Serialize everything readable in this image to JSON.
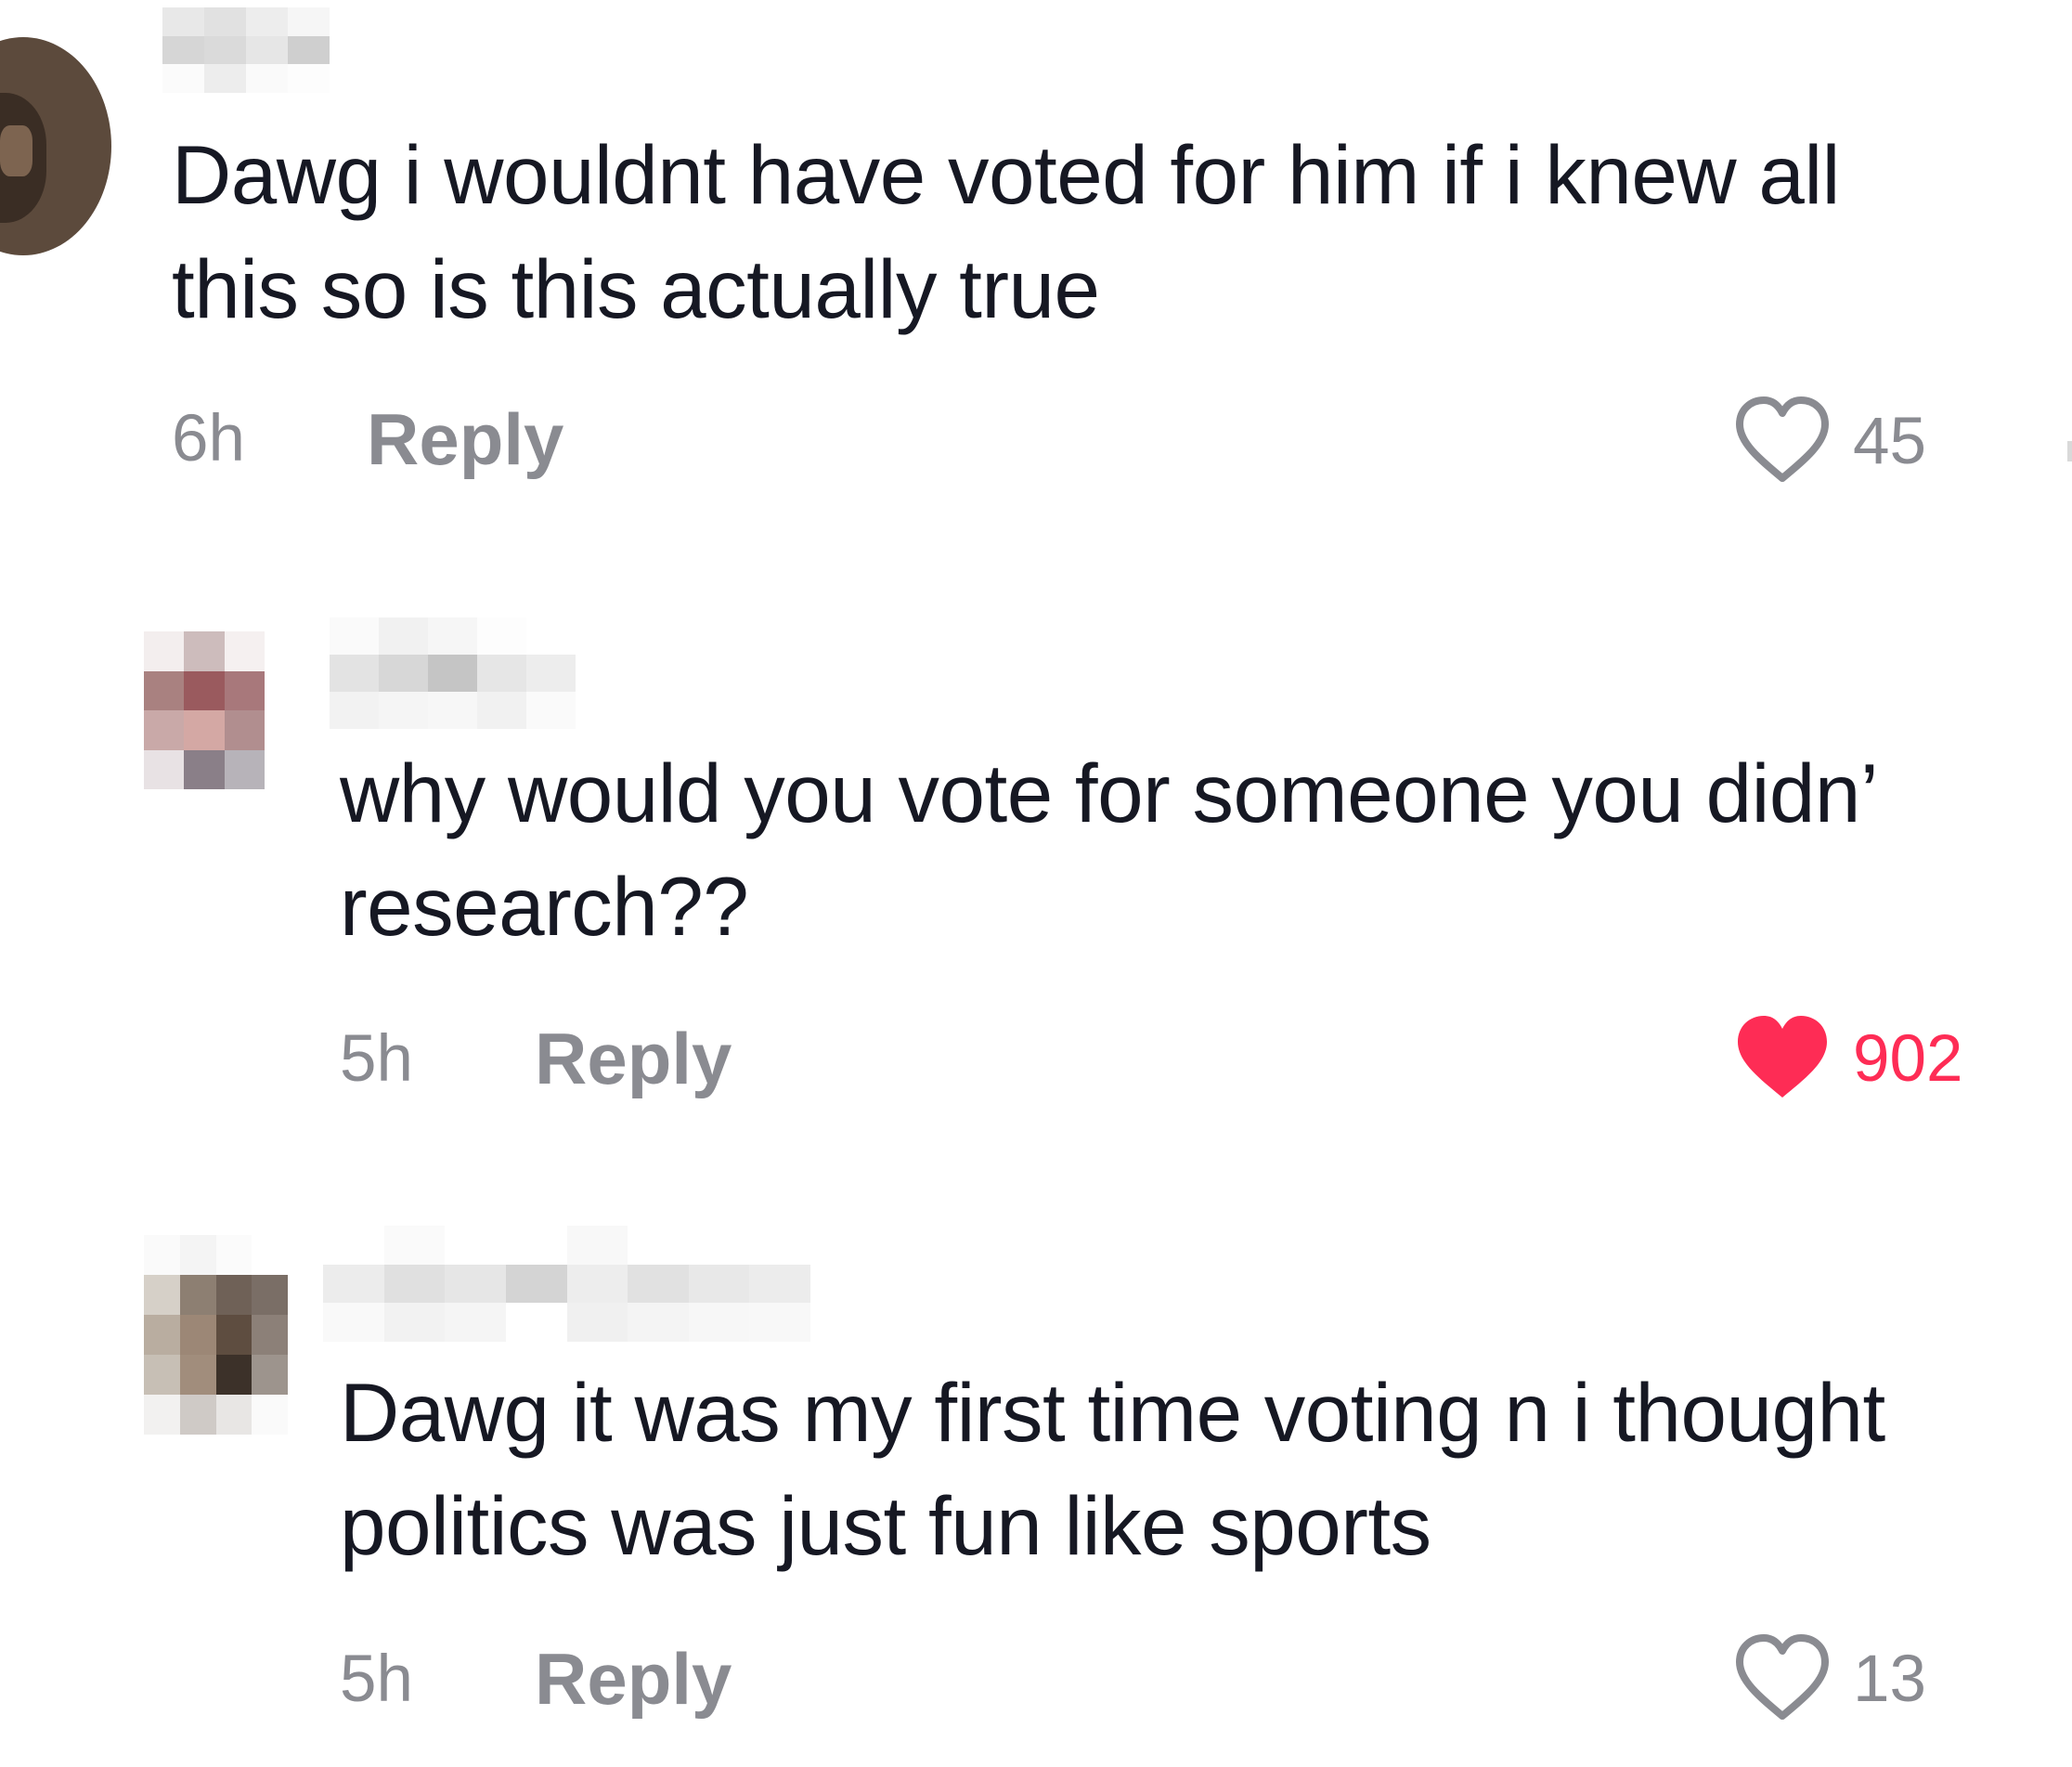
{
  "comments": [
    {
      "text_line1": "Dawg i wouldnt have voted for him if i knew all",
      "text_line2": "this so is this actually true",
      "time": "6h",
      "reply_label": "Reply",
      "likes": "45",
      "liked": false
    },
    {
      "text_line1": "why would you vote for someone you didn’",
      "text_line2": "research??",
      "time": "5h",
      "reply_label": "Reply",
      "likes": "902",
      "liked": true
    },
    {
      "text_line1": "Dawg it was my first time voting n i thought",
      "text_line2": "politics was just fun like sports",
      "time": "5h",
      "reply_label": "Reply",
      "likes": "13",
      "liked": false
    }
  ],
  "colors": {
    "like_active": "#fe2c55",
    "muted_text": "#8a8b91",
    "body_text": "#161823"
  },
  "icons": {
    "like_outline": "heart-outline-icon",
    "like_filled": "heart-filled-icon"
  }
}
